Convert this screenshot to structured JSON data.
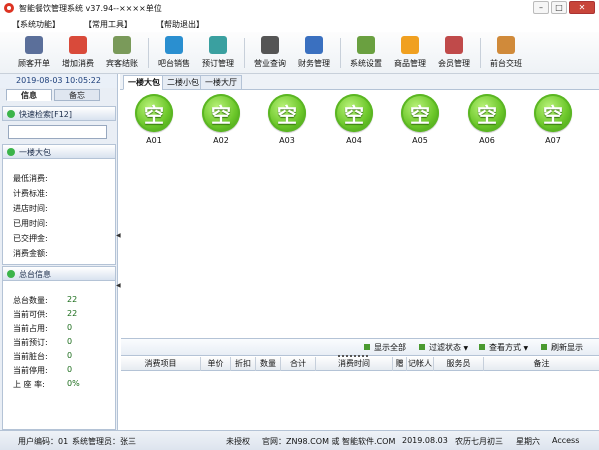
{
  "window": {
    "title": "智能餐饮管理系统 v37.94--××××单位",
    "controls": [
      "–",
      "□",
      "✕"
    ]
  },
  "menu": [
    "【系统功能】",
    "【常用工具】",
    "【帮助退出】"
  ],
  "toolbar": [
    {
      "label": "顾客开单",
      "icon": "customer-icon",
      "color": "#5b6f9a"
    },
    {
      "label": "增加消费",
      "icon": "add-consume-icon",
      "color": "#d94a3a"
    },
    {
      "label": "宾客结账",
      "icon": "checkout-icon",
      "color": "#7a9a5a"
    },
    {
      "label": "吧台销售",
      "icon": "bar-sales-icon",
      "color": "#2a8fd0"
    },
    {
      "label": "预订管理",
      "icon": "reservation-icon",
      "color": "#3aa0a0"
    },
    {
      "label": "营业查询",
      "icon": "search-icon",
      "color": "#555555"
    },
    {
      "label": "财务管理",
      "icon": "finance-icon",
      "color": "#3a70c0"
    },
    {
      "label": "系统设置",
      "icon": "gear-icon",
      "color": "#6aa040"
    },
    {
      "label": "商品管理",
      "icon": "star-icon",
      "color": "#f0a020"
    },
    {
      "label": "会员管理",
      "icon": "members-icon",
      "color": "#c04a4a"
    },
    {
      "label": "前台交班",
      "icon": "shift-handover-icon",
      "color": "#d08a3a"
    }
  ],
  "left_panel": {
    "datetime": "2019-08-03  10:05:22",
    "tabs": [
      "信息",
      "备忘"
    ],
    "quick_search_label": "快速检索[F12]",
    "search_value": "",
    "current_room_label": "一楼大包",
    "room_fields": [
      "最低消费:",
      "计费标准:",
      "进店时间:",
      "已用时间:",
      "已交押金:",
      "消费金额:"
    ],
    "summary_label": "总台信息",
    "summary": [
      {
        "label": "总台数量:",
        "value": "22"
      },
      {
        "label": "当前可供:",
        "value": "22"
      },
      {
        "label": "当前占用:",
        "value": "0"
      },
      {
        "label": "当前预订:",
        "value": "0"
      },
      {
        "label": "当前脏台:",
        "value": "0"
      },
      {
        "label": "当前停用:",
        "value": "0"
      },
      {
        "label": "上 座 率:",
        "value": "0%"
      }
    ]
  },
  "room_tabs": [
    "一楼大包",
    "二楼小包",
    "一楼大厅"
  ],
  "tables": [
    {
      "code": "A01",
      "status": "空"
    },
    {
      "code": "A02",
      "status": "空"
    },
    {
      "code": "A03",
      "status": "空"
    },
    {
      "code": "A04",
      "status": "空"
    },
    {
      "code": "A05",
      "status": "空"
    },
    {
      "code": "A06",
      "status": "空"
    },
    {
      "code": "A07",
      "status": "空"
    }
  ],
  "filterbar": [
    "显示全部",
    "过滤状态",
    "查看方式",
    "刷新显示"
  ],
  "order_columns": [
    "消费项目",
    "单价",
    "折扣",
    "数量",
    "合计",
    "消费时间",
    "赠",
    "记帐人",
    "服务员",
    "备注"
  ],
  "status_bar": {
    "user": "用户编码：01",
    "operator": "系统管理员：张三",
    "license": "未授权",
    "website": "官网：ZN98.COM 或 智能软件.COM",
    "date": "2019.08.03",
    "lunar": "农历七月初三",
    "weekday": "星期六",
    "db": "Access"
  }
}
